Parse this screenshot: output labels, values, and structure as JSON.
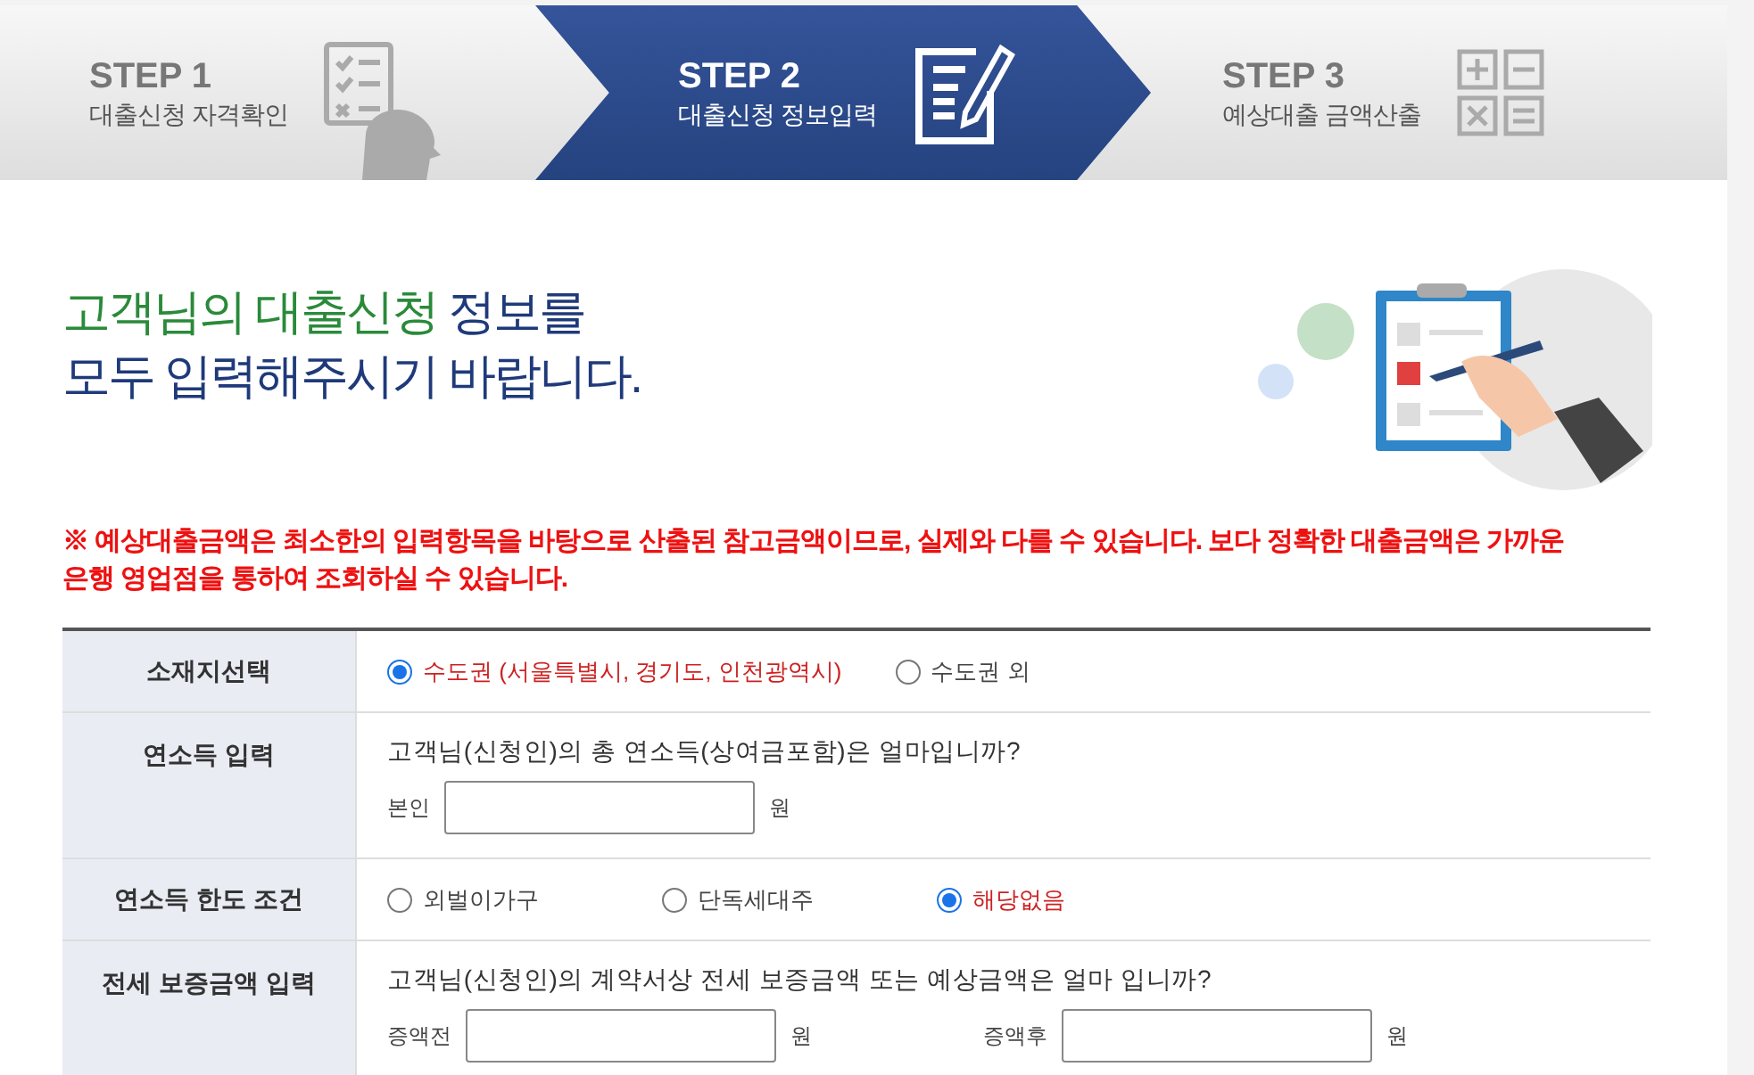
{
  "steps": [
    {
      "kind": "checklist",
      "number": "STEP 1",
      "label": "대출신청 자격확인",
      "selected": false
    },
    {
      "kind": "form",
      "number": "STEP 2",
      "label": "대출신청 정보입력",
      "selected": true
    },
    {
      "kind": "calculator",
      "number": "STEP 3",
      "label": "예상대출 금액산출",
      "selected": false
    }
  ],
  "heading": {
    "highlight": "고객님의 대출신청",
    "rest": " 정보를",
    "line2": "모두 입력해주시기 바랍니다."
  },
  "notice": "※ 예상대출금액은 최소한의 입력항목을 바탕으로 산출된 참고금액이므로, 실제와 다를 수 있습니다. 보다 정확한 대출금액은 가까운 은행 영업점을 통하여 조회하실 수 있습니다.",
  "form_rows": [
    {
      "kind": "radio",
      "label": "소재지선택",
      "options": [
        {
          "label": "수도권 (서울특별시, 경기도, 인천광역시)",
          "selected": true
        },
        {
          "label": "수도권 외",
          "selected": false
        }
      ]
    },
    {
      "kind": "input",
      "label": "연소득 입력",
      "question": "고객님(신청인)의 총 연소득(상여금포함)은 얼마입니까?",
      "fields": [
        {
          "label": "본인",
          "unit": "원"
        }
      ]
    },
    {
      "kind": "radio",
      "label": "연소득 한도 조건",
      "options": [
        {
          "label": "외벌이가구",
          "selected": false
        },
        {
          "label": "단독세대주",
          "selected": false
        },
        {
          "label": "해당없음",
          "selected": true
        }
      ]
    },
    {
      "kind": "input",
      "label": "전세 보증금액 입력",
      "question": "고객님(신청인)의 계약서상 전세 보증금액 또는 예상금액은 얼마 입니까?",
      "fields": [
        {
          "label": "증액전",
          "unit": "원"
        },
        {
          "label": "증액후",
          "unit": "원"
        }
      ]
    }
  ]
}
